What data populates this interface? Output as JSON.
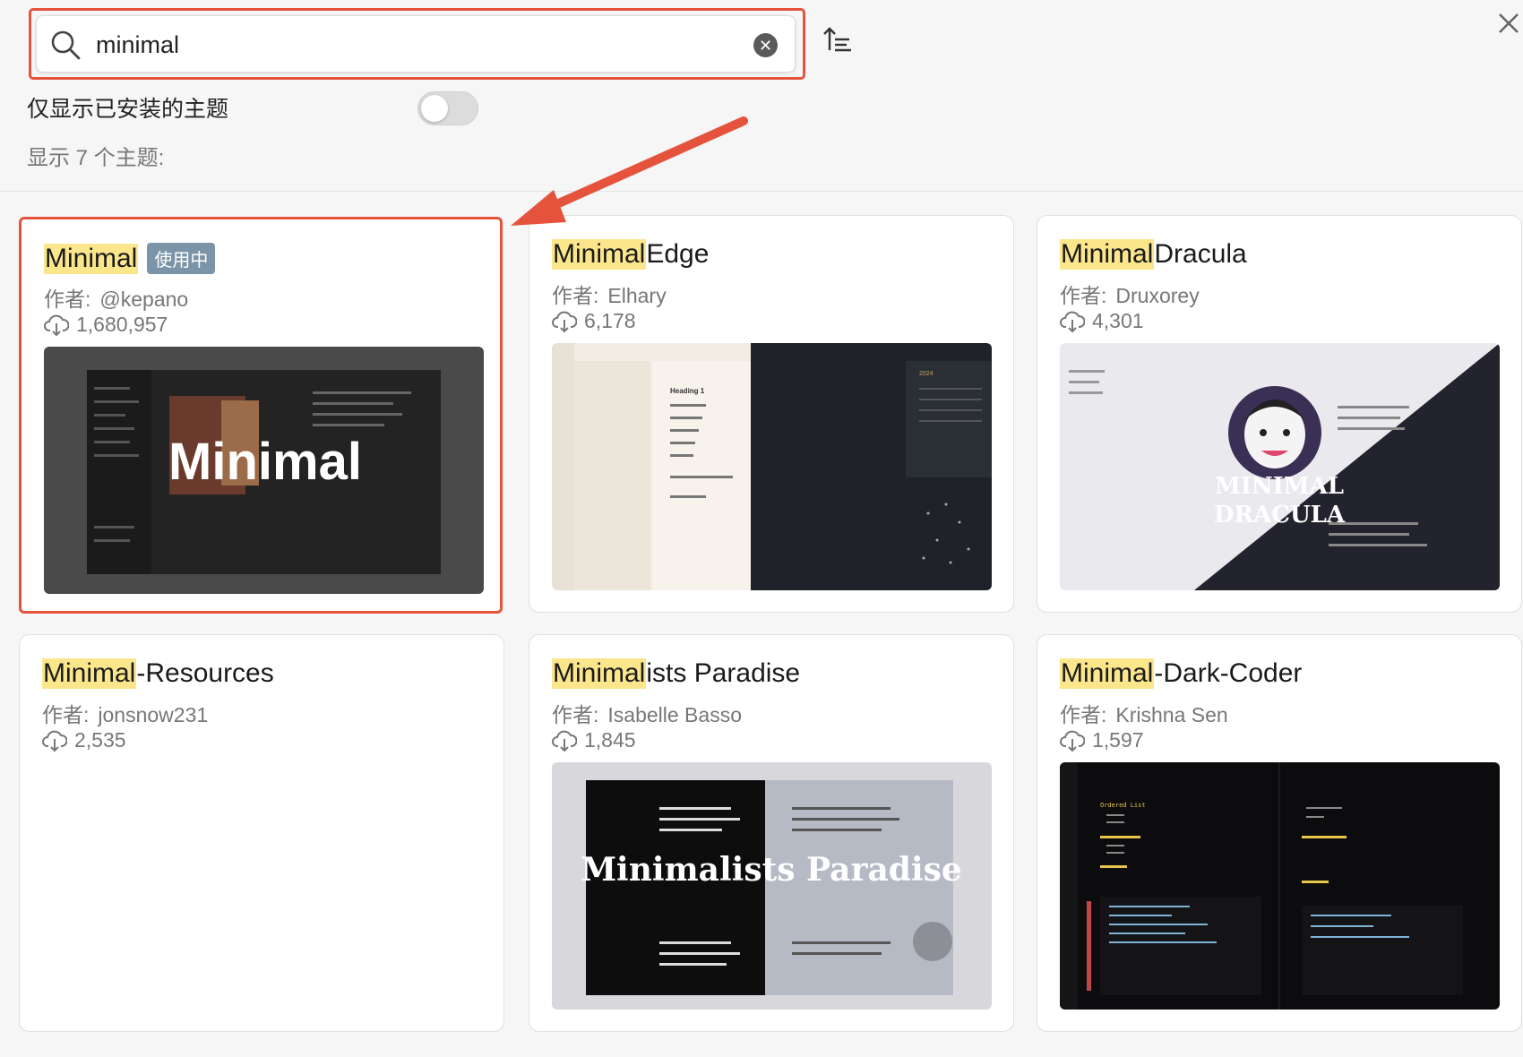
{
  "search": {
    "value": "minimal",
    "placeholder": ""
  },
  "toggle": {
    "label": "仅显示已安装的主题",
    "on": false
  },
  "count_text": "显示 7 个主题:",
  "cards": [
    {
      "highlight": "Minimal",
      "rest": "",
      "badge": "使用中",
      "author_label": "作者:",
      "author": "@kepano",
      "downloads": "1,680,957",
      "preview_text": "Minimal"
    },
    {
      "highlight": "Minimal",
      "rest": " Edge",
      "badge": "",
      "author_label": "作者:",
      "author": "Elhary",
      "downloads": "6,178",
      "preview_text": "Heading 1",
      "preview_year": "2024"
    },
    {
      "highlight": "Minimal",
      "rest": " Dracula",
      "badge": "",
      "author_label": "作者:",
      "author": "Druxorey",
      "downloads": "4,301",
      "preview_text": "MINIMAL",
      "preview_text2": "DRACULA"
    },
    {
      "highlight": "Minimal",
      "rest": "-Resources",
      "badge": "",
      "author_label": "作者:",
      "author": "jonsnow231",
      "downloads": "2,535"
    },
    {
      "highlight": "Minimal",
      "rest": "ists Paradise",
      "badge": "",
      "author_label": "作者:",
      "author": "Isabelle Basso",
      "downloads": "1,845",
      "preview_text": "Minimalists Paradise"
    },
    {
      "highlight": "Minimal",
      "rest": "-Dark-Coder",
      "badge": "",
      "author_label": "作者:",
      "author": "Krishna Sen",
      "downloads": "1,597",
      "preview_text": "Ordered List"
    }
  ],
  "colors": {
    "accent": "#e5533c",
    "highlight": "#fbe68c",
    "badge": "#7b94a8"
  }
}
